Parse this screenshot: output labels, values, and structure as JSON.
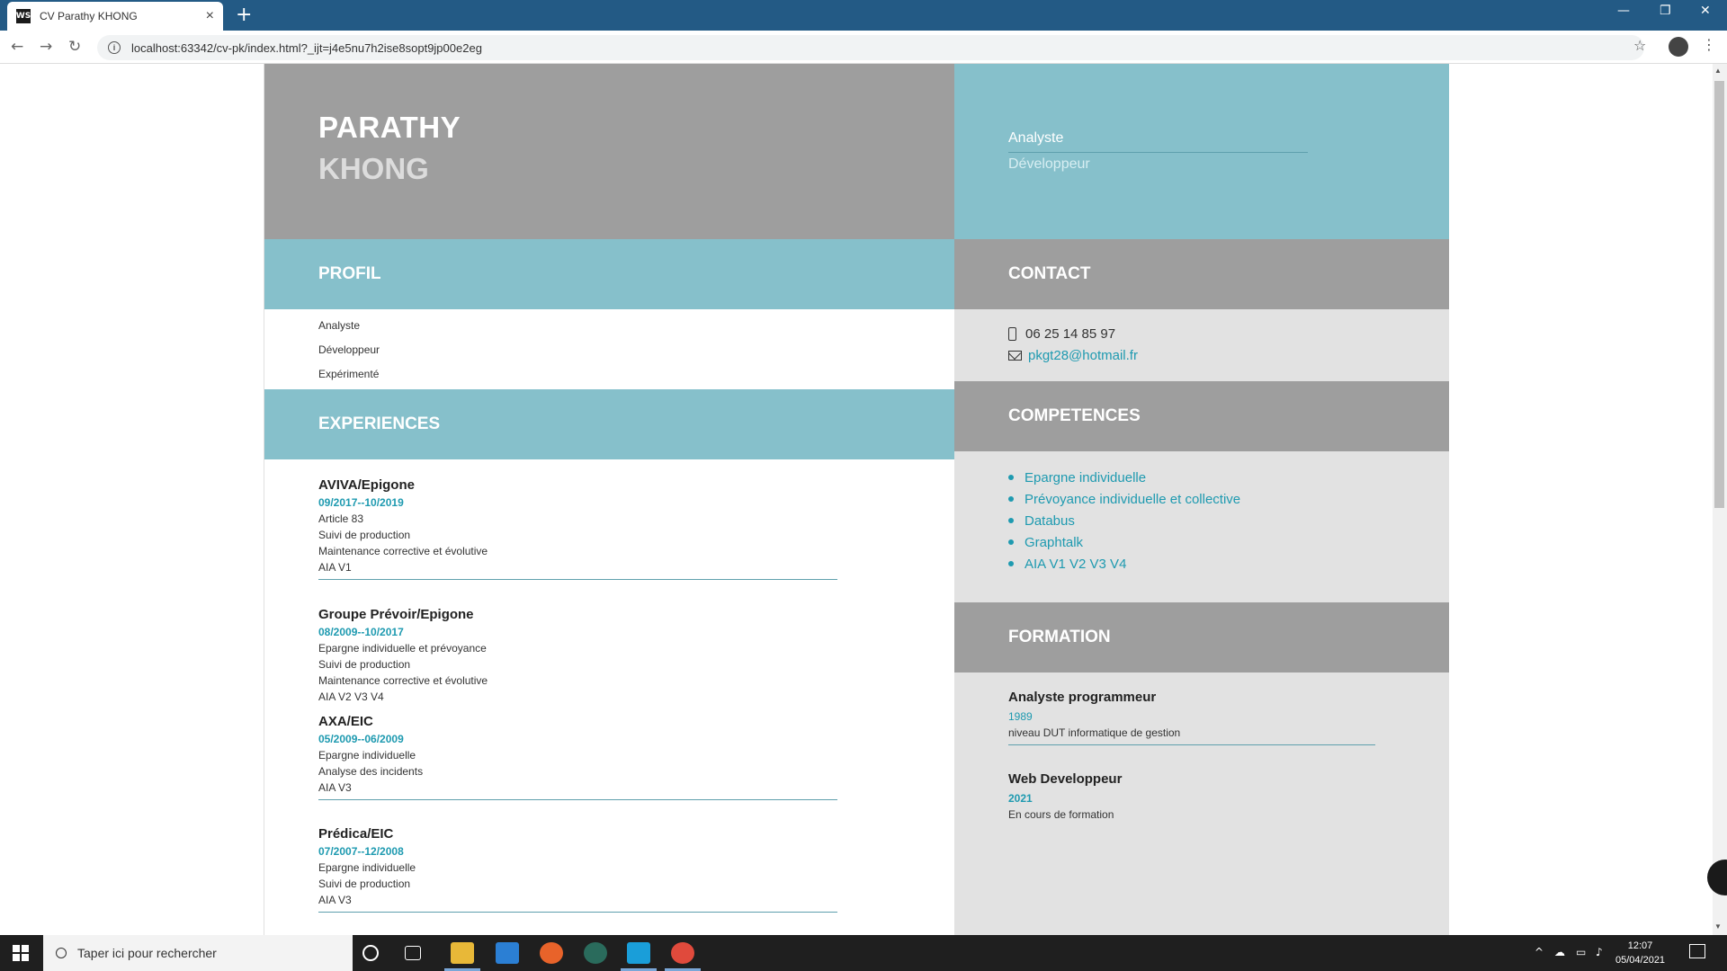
{
  "browser": {
    "tab_title": "CV Parathy KHONG",
    "tab_favicon": "WS",
    "url": "localhost:63342/cv-pk/index.html?_ijt=j4e5nu7h2ise8sopt9jp00e2eg"
  },
  "header": {
    "first_name": "PARATHY",
    "last_name": "KHONG",
    "job_title_1": "Analyste",
    "job_title_2": "Développeur"
  },
  "profil": {
    "heading": "PROFIL",
    "items": [
      "Analyste",
      "Développeur",
      "Expérimenté"
    ]
  },
  "experiences": {
    "heading": "EXPERIENCES",
    "items": [
      {
        "title": "AVIVA/Epigone",
        "date": "09/2017--10/2019",
        "lines": [
          "Article 83",
          "Suivi de production",
          "Maintenance corrective et évolutive",
          "AIA V1"
        ]
      },
      {
        "title": "Groupe Prévoir/Epigone",
        "date": "08/2009--10/2017",
        "lines": [
          "Epargne individuelle et prévoyance",
          "Suivi de production",
          "Maintenance corrective et évolutive",
          "AIA V2 V3 V4"
        ]
      },
      {
        "title": "AXA/EIC",
        "date": "05/2009--06/2009",
        "lines": [
          "Epargne individuelle",
          "Analyse des incidents",
          "AIA V3"
        ]
      },
      {
        "title": "Prédica/EIC",
        "date": "07/2007--12/2008",
        "lines": [
          "Epargne individuelle",
          "Suivi de production",
          "AIA V3"
        ]
      }
    ]
  },
  "contact": {
    "heading": "CONTACT",
    "phone": "06 25 14 85 97",
    "email": "pkgt28@hotmail.fr"
  },
  "competences": {
    "heading": "COMPETENCES",
    "items": [
      "Epargne individuelle",
      "Prévoyance individuelle et collective",
      "Databus",
      "Graphtalk",
      "AIA V1 V2 V3 V4"
    ]
  },
  "formation": {
    "heading": "FORMATION",
    "items": [
      {
        "title": "Analyste programmeur",
        "year": "1989",
        "desc": "niveau DUT informatique de gestion"
      },
      {
        "title": "Web Developpeur",
        "year": "2021",
        "desc": "En cours de formation"
      }
    ]
  },
  "taskbar": {
    "search_placeholder": "Taper ici pour rechercher",
    "time": "12:07",
    "date": "05/04/2021"
  }
}
